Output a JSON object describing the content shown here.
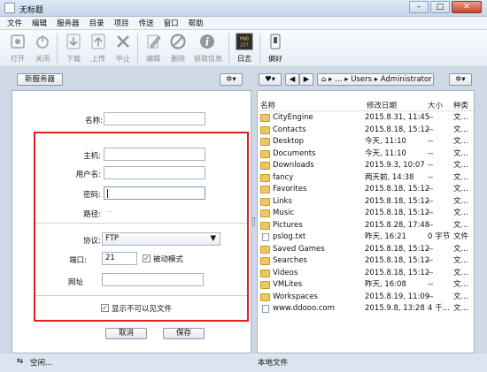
{
  "window": {
    "title": "无标题",
    "controls": [
      "–",
      "□",
      "✕"
    ]
  },
  "menu": [
    "文件",
    "编辑",
    "服务器",
    "目录",
    "项目",
    "传送",
    "窗口",
    "帮助"
  ],
  "toolbar": {
    "open": "打开",
    "close": "关闭",
    "download": "下载",
    "upload": "上传",
    "abort": "中止",
    "edit": "编辑",
    "delete": "删除",
    "get_info": "获取信息",
    "log": "日志",
    "prefs": "偏好",
    "log_icon_text": "PWD 257"
  },
  "left": {
    "new_server": "新服务器",
    "name_label": "名称:",
    "host_label": "主机:",
    "user_label": "用户名:",
    "password_label": "密码:",
    "path_label": "路径:",
    "path_value": "...",
    "protocol_label": "协议:",
    "protocol_value": "FTP",
    "port_label": "端口:",
    "port_value": "21",
    "passive_label": "被动模式",
    "url_label": "网址",
    "show_hidden_label": "显示不可以见文件",
    "cancel": "取消",
    "save": "保存"
  },
  "right": {
    "path": [
      "Users",
      "Administrator"
    ],
    "columns": {
      "name": "名称",
      "date": "修改日期",
      "size": "大小",
      "type": "种类"
    },
    "rows": [
      {
        "name": "CityEngine",
        "date": "2015.8.31, 11:45",
        "size": "--",
        "type": "文...",
        "kind": "folder"
      },
      {
        "name": "Contacts",
        "date": "2015.8.18, 15:12",
        "size": "--",
        "type": "文...",
        "kind": "folder"
      },
      {
        "name": "Desktop",
        "date": "今天, 11:10",
        "size": "--",
        "type": "文...",
        "kind": "folder"
      },
      {
        "name": "Documents",
        "date": "今天, 11:10",
        "size": "--",
        "type": "文...",
        "kind": "folder"
      },
      {
        "name": "Downloads",
        "date": "2015.9.3, 10:07",
        "size": "--",
        "type": "文...",
        "kind": "folder"
      },
      {
        "name": "fancy",
        "date": "两天前, 14:38",
        "size": "--",
        "type": "文...",
        "kind": "folder"
      },
      {
        "name": "Favorites",
        "date": "2015.8.18, 15:12",
        "size": "--",
        "type": "文...",
        "kind": "folder"
      },
      {
        "name": "Links",
        "date": "2015.8.18, 15:12",
        "size": "--",
        "type": "文...",
        "kind": "folder"
      },
      {
        "name": "Music",
        "date": "2015.8.18, 15:12",
        "size": "--",
        "type": "文...",
        "kind": "folder"
      },
      {
        "name": "Pictures",
        "date": "2015.8.28, 17:48",
        "size": "--",
        "type": "文...",
        "kind": "folder"
      },
      {
        "name": "pslog.txt",
        "date": "昨天, 16:21",
        "size": "0 字节",
        "type": "文件",
        "kind": "file"
      },
      {
        "name": "Saved Games",
        "date": "2015.8.18, 15:12",
        "size": "--",
        "type": "文...",
        "kind": "folder"
      },
      {
        "name": "Searches",
        "date": "2015.8.18, 15:12",
        "size": "--",
        "type": "文...",
        "kind": "folder"
      },
      {
        "name": "Videos",
        "date": "2015.8.18, 15:12",
        "size": "--",
        "type": "文...",
        "kind": "folder"
      },
      {
        "name": "VMLites",
        "date": "昨天, 16:08",
        "size": "--",
        "type": "文...",
        "kind": "folder"
      },
      {
        "name": "Workspaces",
        "date": "2015.8.19, 11:09",
        "size": "--",
        "type": "文...",
        "kind": "folder"
      },
      {
        "name": "www.ddooo.com",
        "date": "2015.9.8, 13:28",
        "size": "4 千...",
        "type": "文...",
        "kind": "file"
      }
    ]
  },
  "status": {
    "left": "空闲...",
    "right": "本地文件"
  },
  "colors": {
    "highlight_box": "#e0201c",
    "folder": "#efc75e"
  }
}
